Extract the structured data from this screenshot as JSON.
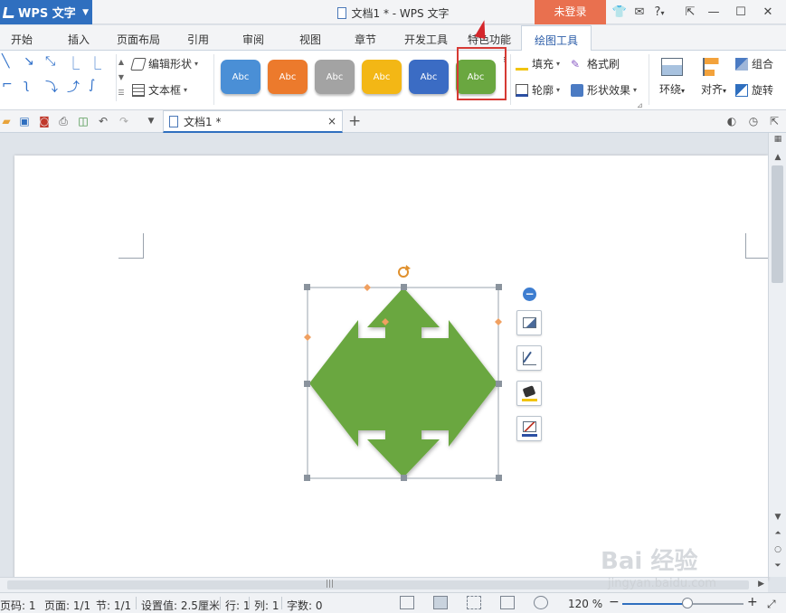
{
  "titlebar": {
    "app_name": "WPS 文字",
    "document_title": "文档1 * - WPS 文字",
    "login_label": "未登录",
    "help_label": "?"
  },
  "ribbon_tabs": [
    {
      "label": "开始"
    },
    {
      "label": "插入"
    },
    {
      "label": "页面布局"
    },
    {
      "label": "引用"
    },
    {
      "label": "审阅"
    },
    {
      "label": "视图"
    },
    {
      "label": "章节"
    },
    {
      "label": "开发工具"
    },
    {
      "label": "特色功能"
    },
    {
      "label": "绘图工具"
    }
  ],
  "ribbon": {
    "edit_shape_label": "编辑形状",
    "textbox_label": "文本框",
    "style_presets": [
      {
        "label": "Abc",
        "color": "#4a8fd6"
      },
      {
        "label": "Abc",
        "color": "#ec7a2c"
      },
      {
        "label": "Abc",
        "color": "#a3a3a3"
      },
      {
        "label": "Abc",
        "color": "#f3b715"
      },
      {
        "label": "Abc",
        "color": "#3b6cc4"
      },
      {
        "label": "Abc",
        "color": "#6aa740"
      }
    ],
    "fill_label": "填充",
    "format_painter_label": "格式刷",
    "outline_label": "轮廓",
    "shape_effects_label": "形状效果",
    "wrap_label": "环绕",
    "align_label": "对齐",
    "group_label": "组合",
    "rotate_label": "旋转"
  },
  "doc_tabs": {
    "active_tab": "文档1 *",
    "close_symbol": "×",
    "add_symbol": "+"
  },
  "shape": {
    "fill_color": "#6aa740",
    "type": "four-way-arrow"
  },
  "statusbar": {
    "page_code": "页码: 1",
    "page": "页面: 1/1",
    "section": "节: 1/1",
    "set_value": "设置值: 2.5厘米",
    "row": "行: 1",
    "column": "列: 1",
    "word_count": "字数: 0",
    "zoom": "120 %",
    "zoom_minus": "−",
    "zoom_plus": "+",
    "zoom_level_fraction": 0.54
  },
  "watermark": {
    "main": "Bai 经验",
    "sub": "jingyan.baidu.com"
  }
}
